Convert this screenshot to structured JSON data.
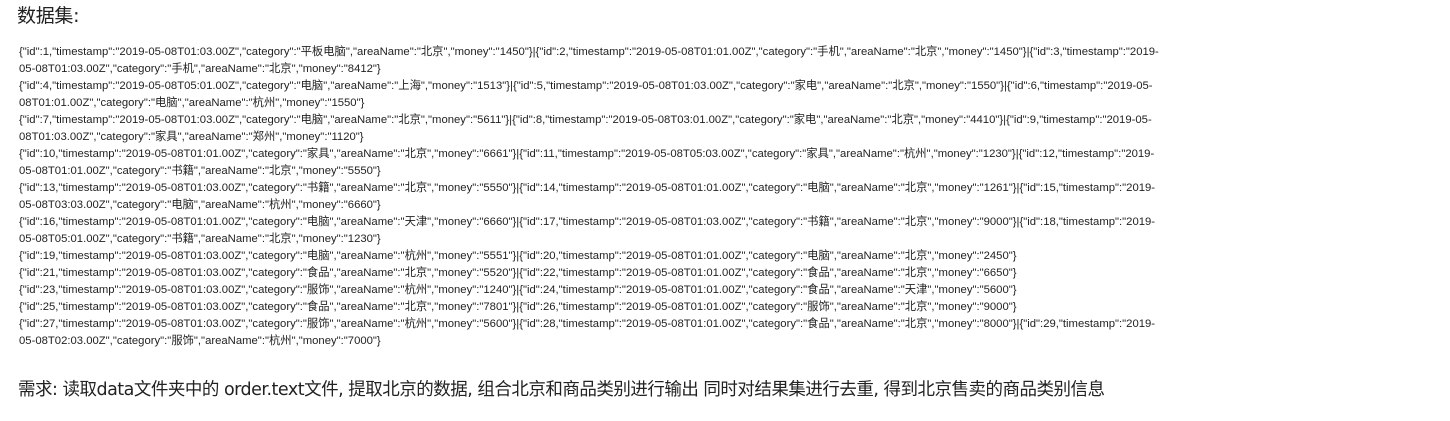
{
  "document": {
    "title": "数据集:",
    "dataset_lines": [
      "{\"id\":1,\"timestamp\":\"2019-05-08T01:03.00Z\",\"category\":\"平板电脑\",\"areaName\":\"北京\",\"money\":\"1450\"}|{\"id\":2,\"timestamp\":\"2019-05-08T01:01.00Z\",\"category\":\"手机\",\"areaName\":\"北京\",\"money\":\"1450\"}|{\"id\":3,\"timestamp\":\"2019-",
      "05-08T01:03.00Z\",\"category\":\"手机\",\"areaName\":\"北京\",\"money\":\"8412\"}",
      "{\"id\":4,\"timestamp\":\"2019-05-08T05:01.00Z\",\"category\":\"电脑\",\"areaName\":\"上海\",\"money\":\"1513\"}|{\"id\":5,\"timestamp\":\"2019-05-08T01:03.00Z\",\"category\":\"家电\",\"areaName\":\"北京\",\"money\":\"1550\"}|{\"id\":6,\"timestamp\":\"2019-05-",
      "08T01:01.00Z\",\"category\":\"电脑\",\"areaName\":\"杭州\",\"money\":\"1550\"}",
      "{\"id\":7,\"timestamp\":\"2019-05-08T01:03.00Z\",\"category\":\"电脑\",\"areaName\":\"北京\",\"money\":\"5611\"}|{\"id\":8,\"timestamp\":\"2019-05-08T03:01.00Z\",\"category\":\"家电\",\"areaName\":\"北京\",\"money\":\"4410\"}|{\"id\":9,\"timestamp\":\"2019-05-",
      "08T01:03.00Z\",\"category\":\"家具\",\"areaName\":\"郑州\",\"money\":\"1120\"}",
      "{\"id\":10,\"timestamp\":\"2019-05-08T01:01.00Z\",\"category\":\"家具\",\"areaName\":\"北京\",\"money\":\"6661\"}|{\"id\":11,\"timestamp\":\"2019-05-08T05:03.00Z\",\"category\":\"家具\",\"areaName\":\"杭州\",\"money\":\"1230\"}|{\"id\":12,\"timestamp\":\"2019-",
      "05-08T01:01.00Z\",\"category\":\"书籍\",\"areaName\":\"北京\",\"money\":\"5550\"}",
      "{\"id\":13,\"timestamp\":\"2019-05-08T01:03.00Z\",\"category\":\"书籍\",\"areaName\":\"北京\",\"money\":\"5550\"}|{\"id\":14,\"timestamp\":\"2019-05-08T01:01.00Z\",\"category\":\"电脑\",\"areaName\":\"北京\",\"money\":\"1261\"}|{\"id\":15,\"timestamp\":\"2019-",
      "05-08T03:03.00Z\",\"category\":\"电脑\",\"areaName\":\"杭州\",\"money\":\"6660\"}",
      "{\"id\":16,\"timestamp\":\"2019-05-08T01:01.00Z\",\"category\":\"电脑\",\"areaName\":\"天津\",\"money\":\"6660\"}|{\"id\":17,\"timestamp\":\"2019-05-08T01:03.00Z\",\"category\":\"书籍\",\"areaName\":\"北京\",\"money\":\"9000\"}|{\"id\":18,\"timestamp\":\"2019-",
      "05-08T05:01.00Z\",\"category\":\"书籍\",\"areaName\":\"北京\",\"money\":\"1230\"}",
      "{\"id\":19,\"timestamp\":\"2019-05-08T01:03.00Z\",\"category\":\"电脑\",\"areaName\":\"杭州\",\"money\":\"5551\"}|{\"id\":20,\"timestamp\":\"2019-05-08T01:01.00Z\",\"category\":\"电脑\",\"areaName\":\"北京\",\"money\":\"2450\"}",
      "{\"id\":21,\"timestamp\":\"2019-05-08T01:03.00Z\",\"category\":\"食品\",\"areaName\":\"北京\",\"money\":\"5520\"}|{\"id\":22,\"timestamp\":\"2019-05-08T01:01.00Z\",\"category\":\"食品\",\"areaName\":\"北京\",\"money\":\"6650\"}",
      "{\"id\":23,\"timestamp\":\"2019-05-08T01:03.00Z\",\"category\":\"服饰\",\"areaName\":\"杭州\",\"money\":\"1240\"}|{\"id\":24,\"timestamp\":\"2019-05-08T01:01.00Z\",\"category\":\"食品\",\"areaName\":\"天津\",\"money\":\"5600\"}",
      "{\"id\":25,\"timestamp\":\"2019-05-08T01:03.00Z\",\"category\":\"食品\",\"areaName\":\"北京\",\"money\":\"7801\"}|{\"id\":26,\"timestamp\":\"2019-05-08T01:01.00Z\",\"category\":\"服饰\",\"areaName\":\"北京\",\"money\":\"9000\"}",
      "{\"id\":27,\"timestamp\":\"2019-05-08T01:03.00Z\",\"category\":\"服饰\",\"areaName\":\"杭州\",\"money\":\"5600\"}|{\"id\":28,\"timestamp\":\"2019-05-08T01:01.00Z\",\"category\":\"食品\",\"areaName\":\"北京\",\"money\":\"8000\"}|{\"id\":29,\"timestamp\":\"2019-",
      "05-08T02:03.00Z\",\"category\":\"服饰\",\"areaName\":\"杭州\",\"money\":\"7000\"}"
    ],
    "requirement": "需求: 读取data文件夹中的 order.text文件, 提取北京的数据, 组合北京和商品类别进行输出  同时对结果集进行去重, 得到北京售卖的商品类别信息"
  }
}
